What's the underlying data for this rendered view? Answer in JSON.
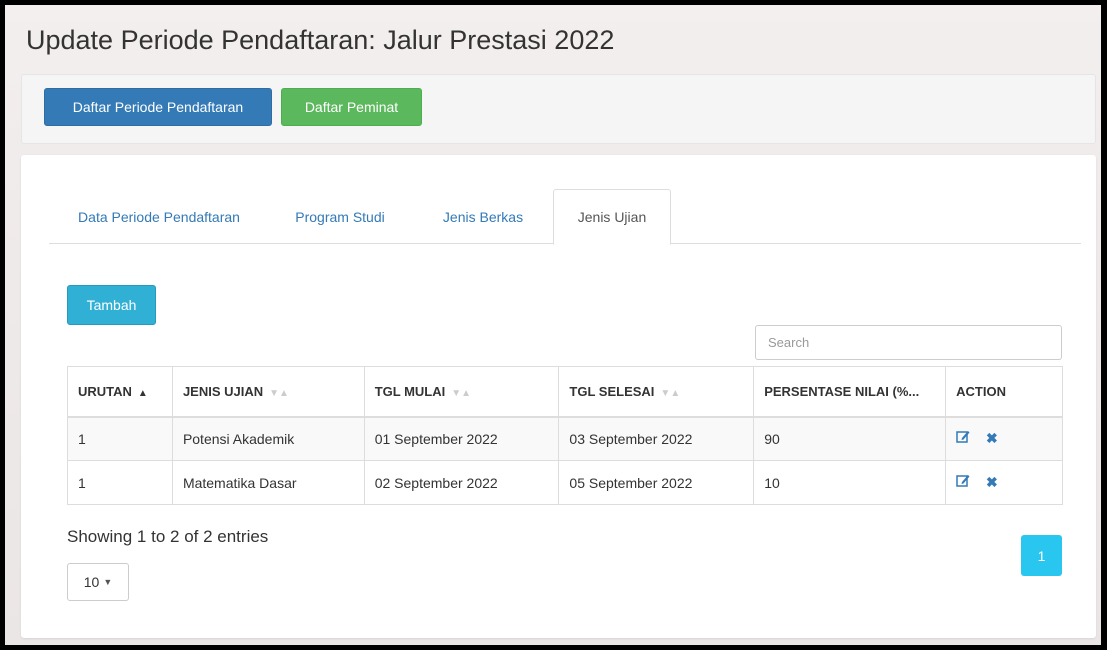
{
  "page": {
    "title": "Update Periode Pendaftaran: Jalur Prestasi 2022"
  },
  "toolbar": {
    "btn_daftar_periode": "Daftar Periode Pendaftaran",
    "btn_daftar_peminat": "Daftar Peminat"
  },
  "tabs": [
    {
      "label": "Data Periode Pendaftaran",
      "active": false
    },
    {
      "label": "Program Studi",
      "active": false
    },
    {
      "label": "Jenis Berkas",
      "active": false
    },
    {
      "label": "Jenis Ujian",
      "active": true
    }
  ],
  "actions": {
    "add_label": "Tambah"
  },
  "search": {
    "placeholder": "Search",
    "value": ""
  },
  "table": {
    "columns": [
      {
        "label": "URUTAN",
        "sort": "asc"
      },
      {
        "label": "JENIS UJIAN",
        "sort": "none"
      },
      {
        "label": "TGL MULAI",
        "sort": "none"
      },
      {
        "label": "TGL SELESAI",
        "sort": "none"
      },
      {
        "label": "PERSENTASE NILAI (%...",
        "sort": null
      },
      {
        "label": "ACTION",
        "sort": null
      }
    ],
    "rows": [
      {
        "urutan": "1",
        "jenis_ujian": "Potensi Akademik",
        "tgl_mulai": "01 September 2022",
        "tgl_selesai": "03 September 2022",
        "persentase": "90"
      },
      {
        "urutan": "1",
        "jenis_ujian": "Matematika Dasar",
        "tgl_mulai": "02 September 2022",
        "tgl_selesai": "05 September 2022",
        "persentase": "10"
      }
    ],
    "row_actions": {
      "edit_icon": "edit-icon",
      "delete_icon": "delete-icon"
    }
  },
  "footer": {
    "info": "Showing 1 to 2 of 2 entries",
    "page_length": "10",
    "current_page": "1"
  },
  "colors": {
    "primary": "#337ab7",
    "success": "#5cb85c",
    "info": "#31b0d5",
    "pagination_active": "#29c7f0"
  }
}
